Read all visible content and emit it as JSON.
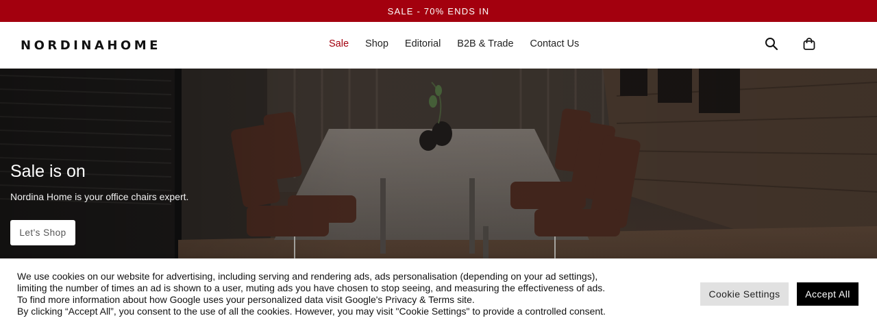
{
  "promo": {
    "text": "SALE - 70% ENDS IN"
  },
  "header": {
    "logo": "NORDINAHOME",
    "nav": [
      {
        "label": "Sale",
        "active": true
      },
      {
        "label": "Shop"
      },
      {
        "label": "Editorial"
      },
      {
        "label": "B2B & Trade"
      },
      {
        "label": "Contact Us"
      }
    ],
    "icons": [
      "search-icon",
      "cart-icon"
    ]
  },
  "hero": {
    "title": "Sale is on",
    "subtitle": "Nordina Home is your office chairs expert.",
    "cta": "Let's Shop"
  },
  "cookie": {
    "lines": [
      "We use cookies on our website for advertising, including serving and rendering ads, ads personalisation (depending on your ad settings),",
      "limiting the number of times an ad is shown to a user, muting ads you have chosen to stop seeing, and measuring the effectiveness of ads.",
      "To find more information about how Google uses your personalized data visit Google's Privacy & Terms site.",
      "By clicking “Accept All”, you consent to the use of all the cookies. However, you may visit \"Cookie Settings\" to provide a controlled consent."
    ],
    "settings_label": "Cookie Settings",
    "accept_label": "Accept All"
  },
  "colors": {
    "brand_red": "#a3000e",
    "black": "#000000"
  }
}
